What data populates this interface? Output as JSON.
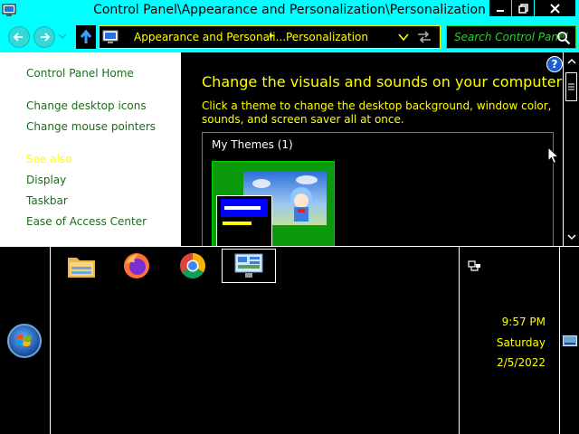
{
  "window": {
    "title": "Control Panel\\Appearance and Personalization\\Personalization"
  },
  "address_bar": {
    "crumb_1": "Appearance and Personali...",
    "separator": "▸",
    "crumb_2": "Personalization"
  },
  "search": {
    "placeholder": "Search Control Panel"
  },
  "left_nav": {
    "home": "Control Panel Home",
    "items": [
      "Change desktop icons",
      "Change mouse pointers"
    ],
    "see_also_heading": "See also",
    "see_also": [
      "Display",
      "Taskbar",
      "Ease of Access Center"
    ]
  },
  "content": {
    "heading": "Change the visuals and sounds on your computer",
    "description": "Click a theme to change the desktop background, window color, sounds, and screen saver all at once.",
    "themes_group": "My Themes (1)"
  },
  "taskbar": {
    "pinned_apps": [
      "file-explorer",
      "firefox",
      "chrome",
      "control-panel"
    ],
    "clock": {
      "time": "9:57 PM",
      "day": "Saturday",
      "date": "2/5/2022"
    }
  },
  "colors": {
    "chrome": "#00ffff",
    "text_highlight": "#ffff00",
    "link": "#1f6b1f",
    "search_accent": "#33cc33",
    "background": "#000000"
  }
}
